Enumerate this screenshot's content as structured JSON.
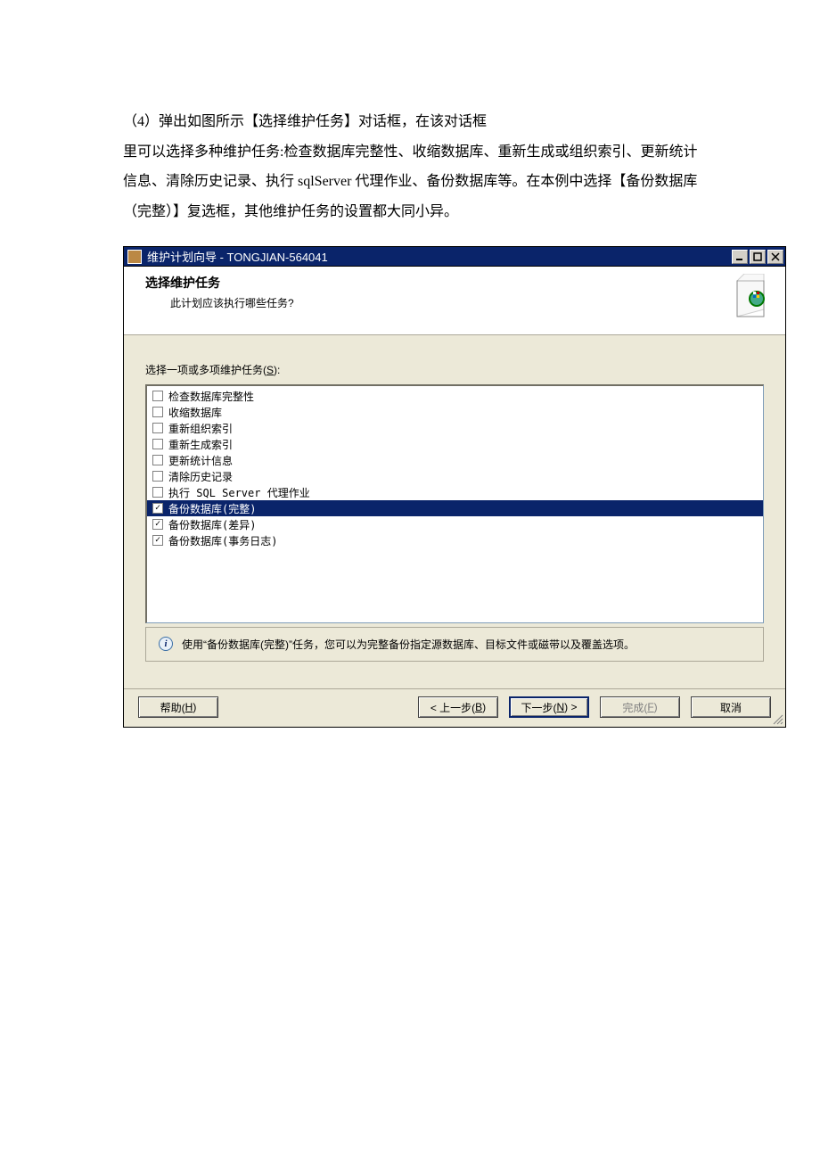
{
  "intro": {
    "line1": "（4）弹出如图所示【选择维护任务】对话框，在该对话框",
    "line2": "里可以选择多种维护任务:检查数据库完整性、收缩数据库、重新生成或组织索引、更新统计信息、清除历史记录、执行 sqlServer 代理作业、备份数据库等。在本例中选择【备份数据库（完整）】复选框，其他维护任务的设置都大同小异。"
  },
  "window": {
    "title": "维护计划向导 - TONGJIAN-564041",
    "header_title": "选择维护任务",
    "header_sub": "此计划应该执行哪些任务?",
    "prompt_pre": "选择一项或多项维护任务(",
    "prompt_hot": "S",
    "prompt_post": "):",
    "items": [
      {
        "label": "检查数据库完整性",
        "checked": false,
        "selected": false
      },
      {
        "label": "收缩数据库",
        "checked": false,
        "selected": false
      },
      {
        "label": "重新组织索引",
        "checked": false,
        "selected": false
      },
      {
        "label": "重新生成索引",
        "checked": false,
        "selected": false
      },
      {
        "label": "更新统计信息",
        "checked": false,
        "selected": false
      },
      {
        "label": "清除历史记录",
        "checked": false,
        "selected": false
      },
      {
        "label": "执行 SQL Server 代理作业",
        "checked": false,
        "selected": false
      },
      {
        "label": "备份数据库(完整)",
        "checked": true,
        "selected": true
      },
      {
        "label": "备份数据库(差异)",
        "checked": true,
        "selected": false
      },
      {
        "label": "备份数据库(事务日志)",
        "checked": true,
        "selected": false
      }
    ],
    "info_text": "使用“备份数据库(完整)”任务，您可以为完整备份指定源数据库、目标文件或磁带以及覆盖选项。",
    "buttons": {
      "help_pre": "帮助(",
      "help_hot": "H",
      "help_post": ")",
      "back_pre": "< 上一步(",
      "back_hot": "B",
      "back_post": ")",
      "next_pre": "下一步(",
      "next_hot": "N",
      "next_post": ") >",
      "finish_pre": "完成(",
      "finish_hot": "F",
      "finish_post": ")",
      "cancel": "取消"
    }
  }
}
